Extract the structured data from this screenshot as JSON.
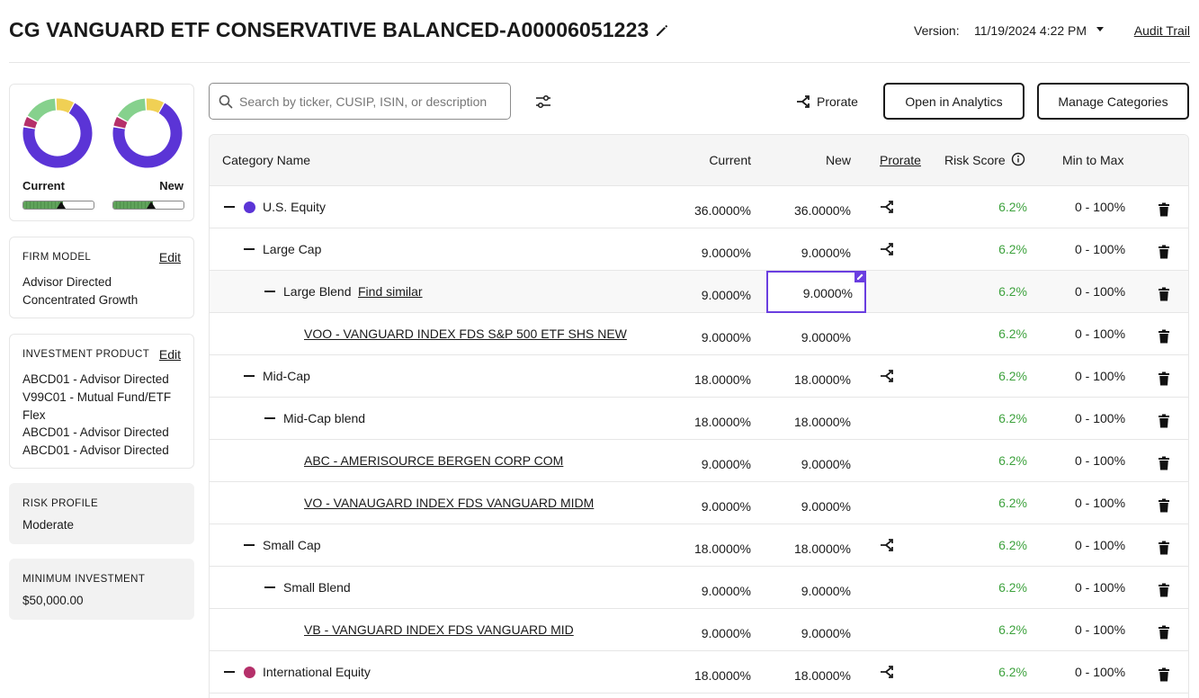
{
  "header": {
    "title": "CG VANGUARD ETF CONSERVATIVE BALANCED-A00006051223",
    "version_label": "Version:",
    "version_value": "11/19/2024 4:22 PM",
    "audit_trail": "Audit Trail"
  },
  "sidebar": {
    "charts": {
      "current_label": "Current",
      "new_label": "New",
      "segment_colors": [
        "#5b34d6",
        "#b5306a",
        "#86d18d",
        "#f0d054"
      ],
      "current_meter_fraction": 0.56,
      "new_meter_fraction": 0.56
    },
    "firm_model": {
      "heading": "FIRM MODEL",
      "edit": "Edit",
      "lines": [
        "Advisor Directed",
        "Concentrated Growth"
      ]
    },
    "investment_product": {
      "heading": "INVESTMENT PRODUCT",
      "edit": "Edit",
      "lines": [
        "ABCD01 - Advisor Directed",
        "V99C01 - Mutual Fund/ETF",
        "Flex",
        "ABCD01 - Advisor Directed",
        "ABCD01 - Advisor Directed"
      ]
    },
    "risk_profile": {
      "heading": "RISK PROFILE",
      "value": "Moderate"
    },
    "minimum_investment": {
      "heading": "MINIMUM INVESTMENT",
      "value": "$50,000.00"
    }
  },
  "toolbar": {
    "search_placeholder": "Search by ticker, CUSIP, ISIN, or description",
    "prorate": "Prorate",
    "open_analytics": "Open in Analytics",
    "manage_categories": "Manage Categories"
  },
  "table": {
    "columns": {
      "category": "Category Name",
      "current": "Current",
      "new": "New",
      "prorate": "Prorate",
      "risk": "Risk Score",
      "minmax": "Min to Max"
    },
    "find_similar": "Find similar",
    "rows": [
      {
        "name": "U.S. Equity",
        "current": "36.0000%",
        "new": "36.0000%",
        "risk": "6.2%",
        "minmax": "0 - 100%"
      },
      {
        "name": "Large Cap",
        "current": "9.0000%",
        "new": "9.0000%",
        "risk": "6.2%",
        "minmax": "0 - 100%"
      },
      {
        "name": "Large Blend",
        "current": "9.0000%",
        "new": "9.0000%",
        "risk": "6.2%",
        "minmax": "0 - 100%"
      },
      {
        "name": "VOO - VANGUARD INDEX FDS S&P 500 ETF SHS NEW",
        "current": "9.0000%",
        "new": "9.0000%",
        "risk": "6.2%",
        "minmax": "0 - 100%"
      },
      {
        "name": "Mid-Cap",
        "current": "18.0000%",
        "new": "18.0000%",
        "risk": "6.2%",
        "minmax": "0 - 100%"
      },
      {
        "name": "Mid-Cap blend",
        "current": "18.0000%",
        "new": "18.0000%",
        "risk": "6.2%",
        "minmax": "0 - 100%"
      },
      {
        "name": "ABC - AMERISOURCE BERGEN CORP COM",
        "current": "9.0000%",
        "new": "9.0000%",
        "risk": "6.2%",
        "minmax": "0 - 100%"
      },
      {
        "name": "VO - VANAUGARD INDEX FDS VANGUARD MIDM",
        "current": "9.0000%",
        "new": "9.0000%",
        "risk": "6.2%",
        "minmax": "0 - 100%"
      },
      {
        "name": "Small Cap",
        "current": "18.0000%",
        "new": "18.0000%",
        "risk": "6.2%",
        "minmax": "0 - 100%"
      },
      {
        "name": "Small Blend",
        "current": "9.0000%",
        "new": "9.0000%",
        "risk": "6.2%",
        "minmax": "0 - 100%"
      },
      {
        "name": "VB - VANGUARD INDEX FDS VANGUARD MID",
        "current": "9.0000%",
        "new": "9.0000%",
        "risk": "6.2%",
        "minmax": "0 - 100%"
      },
      {
        "name": "International Equity",
        "current": "18.0000%",
        "new": "18.0000%",
        "risk": "6.2%",
        "minmax": "0 - 100%"
      }
    ],
    "category_colors": {
      "us_equity": "#5b34d6",
      "international_equity": "#b5306a"
    },
    "risk_color": "#3ea23e"
  }
}
